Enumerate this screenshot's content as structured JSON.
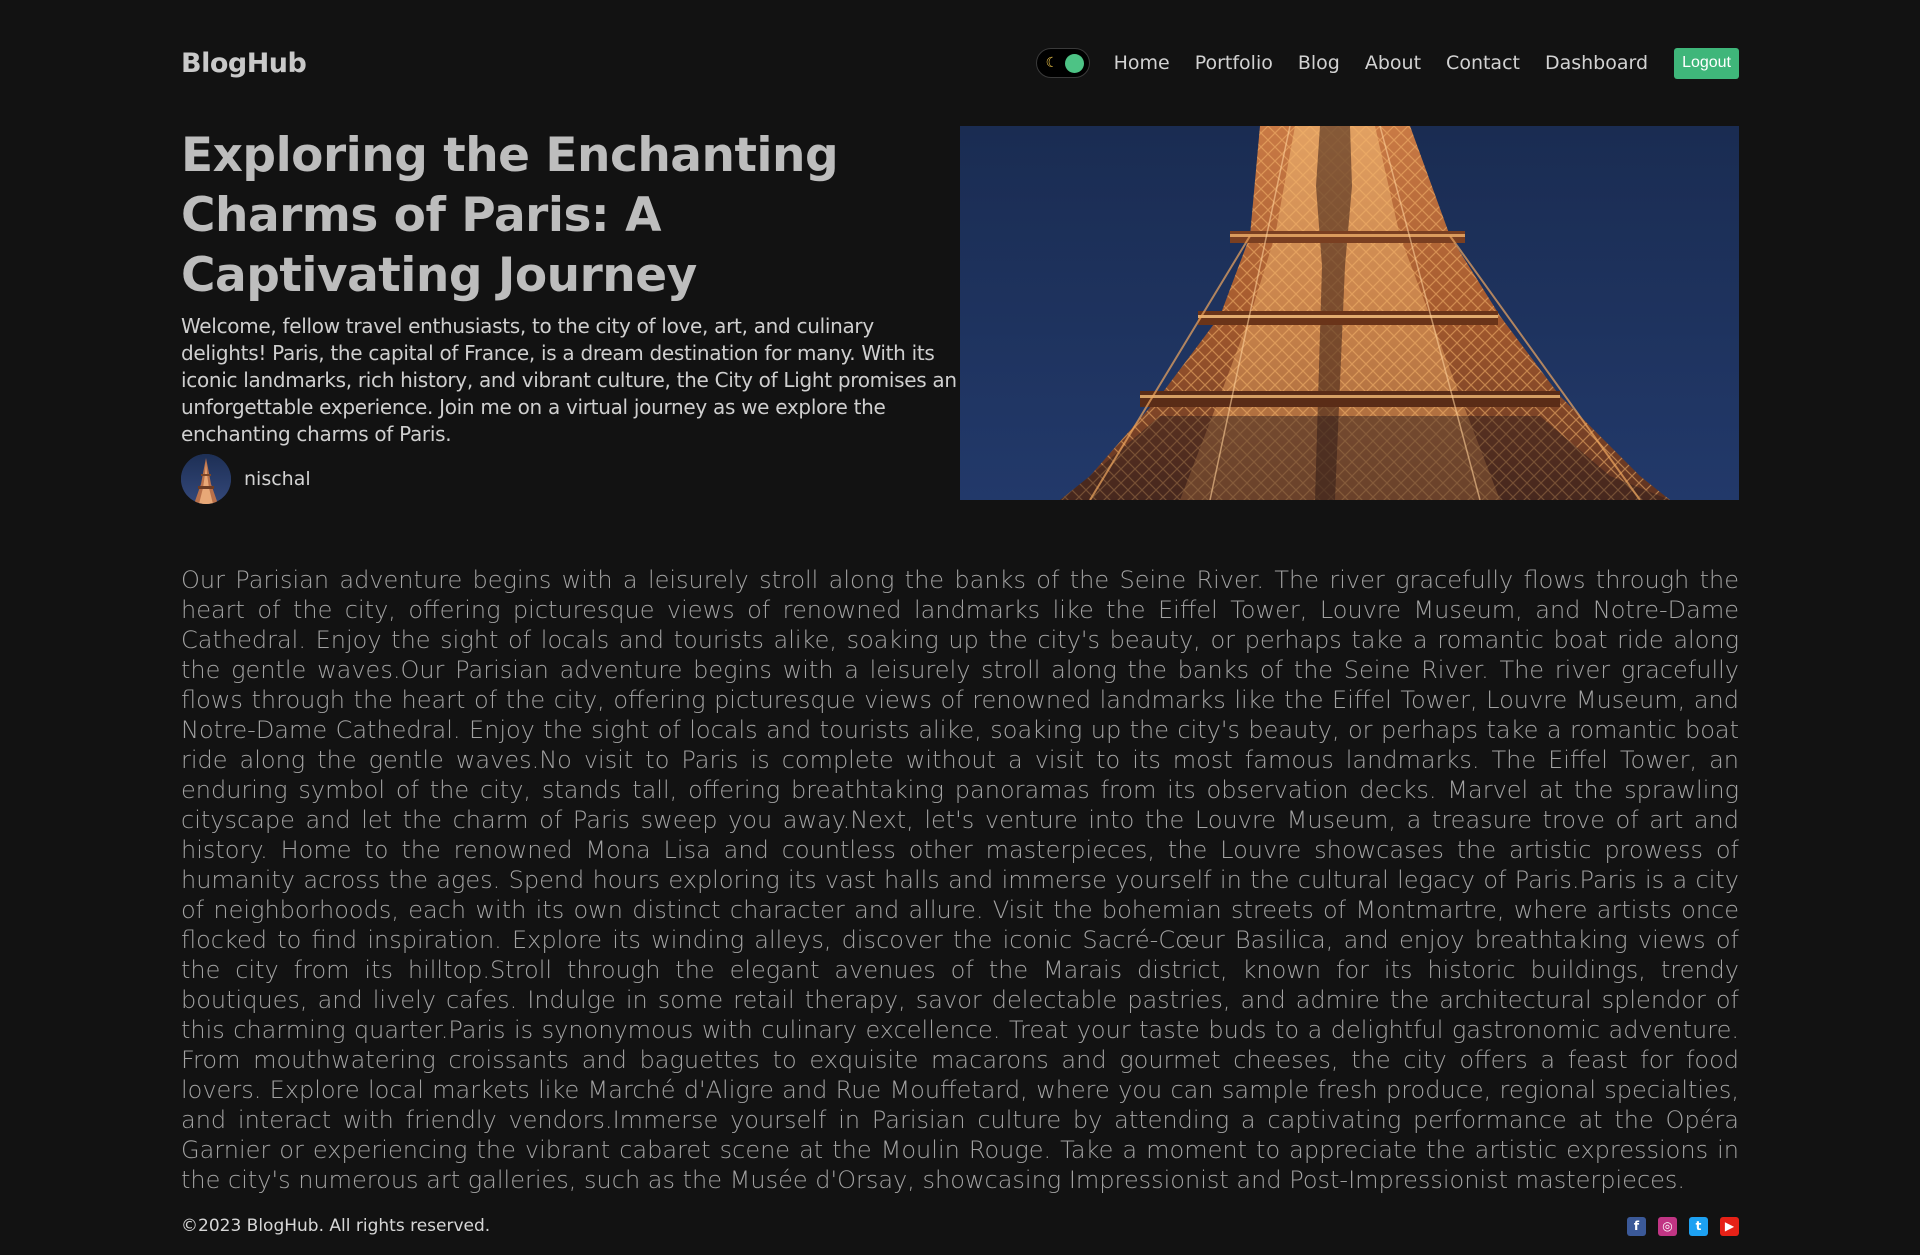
{
  "navbar": {
    "brand": "BlogHub",
    "links": [
      "Home",
      "Portfolio",
      "Blog",
      "About",
      "Contact",
      "Dashboard"
    ],
    "logout_label": "Logout",
    "theme_toggle": {
      "icon": "moon-icon",
      "knob_color": "#4dc385",
      "state": "dark"
    }
  },
  "post": {
    "title": "Exploring the Enchanting Charms of Paris: A Captivating Journey",
    "excerpt": "Welcome, fellow travel enthusiasts, to the city of love, art, and culinary delights! Paris, the capital of France, is a dream destination for many. With its iconic landmarks, rich history, and vibrant culture, the City of Light promises an unforgettable experience. Join me on a virtual journey as we explore the enchanting charms of Paris.",
    "author": "nischal",
    "body": "Our Parisian adventure begins with a leisurely stroll along the banks of the Seine River. The river gracefully flows through the heart of the city, offering picturesque views of renowned landmarks like the Eiffel Tower, Louvre Museum, and Notre-Dame Cathedral. Enjoy the sight of locals and tourists alike, soaking up the city's beauty, or perhaps take a romantic boat ride along the gentle waves.Our Parisian adventure begins with a leisurely stroll along the banks of the Seine River. The river gracefully flows through the heart of the city, offering picturesque views of renowned landmarks like the Eiffel Tower, Louvre Museum, and Notre-Dame Cathedral. Enjoy the sight of locals and tourists alike, soaking up the city's beauty, or perhaps take a romantic boat ride along the gentle waves.No visit to Paris is complete without a visit to its most famous landmarks. The Eiffel Tower, an enduring symbol of the city, stands tall, offering breathtaking panoramas from its observation decks. Marvel at the sprawling cityscape and let the charm of Paris sweep you away.Next, let's venture into the Louvre Museum, a treasure trove of art and history. Home to the renowned Mona Lisa and countless other masterpieces, the Louvre showcases the artistic prowess of humanity across the ages. Spend hours exploring its vast halls and immerse yourself in the cultural legacy of Paris.Paris is a city of neighborhoods, each with its own distinct character and allure. Visit the bohemian streets of Montmartre, where artists once flocked to find inspiration. Explore its winding alleys, discover the iconic Sacré-Cœur Basilica, and enjoy breathtaking views of the city from its hilltop.Stroll through the elegant avenues of the Marais district, known for its historic buildings, trendy boutiques, and lively cafes. Indulge in some retail therapy, savor delectable pastries, and admire the architectural splendor of this charming quarter.Paris is synonymous with culinary excellence. Treat your taste buds to a delightful gastronomic adventure. From mouthwatering croissants and baguettes to exquisite macarons and gourmet cheeses, the city offers a feast for food lovers. Explore local markets like Marché d'Aligre and Rue Mouffetard, where you can sample fresh produce, regional specialties, and interact with friendly vendors.Immerse yourself in Parisian culture by attending a captivating performance at the Opéra Garnier or experiencing the vibrant cabaret scene at the Moulin Rouge. Take a moment to appreciate the artistic expressions in the city's numerous art galleries, such as the Musée d'Orsay, showcasing Impressionist and Post-Impressionist masterpieces."
  },
  "footer": {
    "copyright": "©2023 BlogHub. All rights reserved.",
    "social": [
      {
        "icon": "facebook-icon",
        "glyph": "f",
        "color": "#3b5998"
      },
      {
        "icon": "instagram-icon",
        "glyph": "◎",
        "color": "#c13584"
      },
      {
        "icon": "twitter-icon",
        "glyph": "t",
        "color": "#1da1f2"
      },
      {
        "icon": "youtube-icon",
        "glyph": "▶",
        "color": "#e62117"
      }
    ]
  },
  "colors": {
    "background": "#121212",
    "accent": "#3fb67a"
  }
}
